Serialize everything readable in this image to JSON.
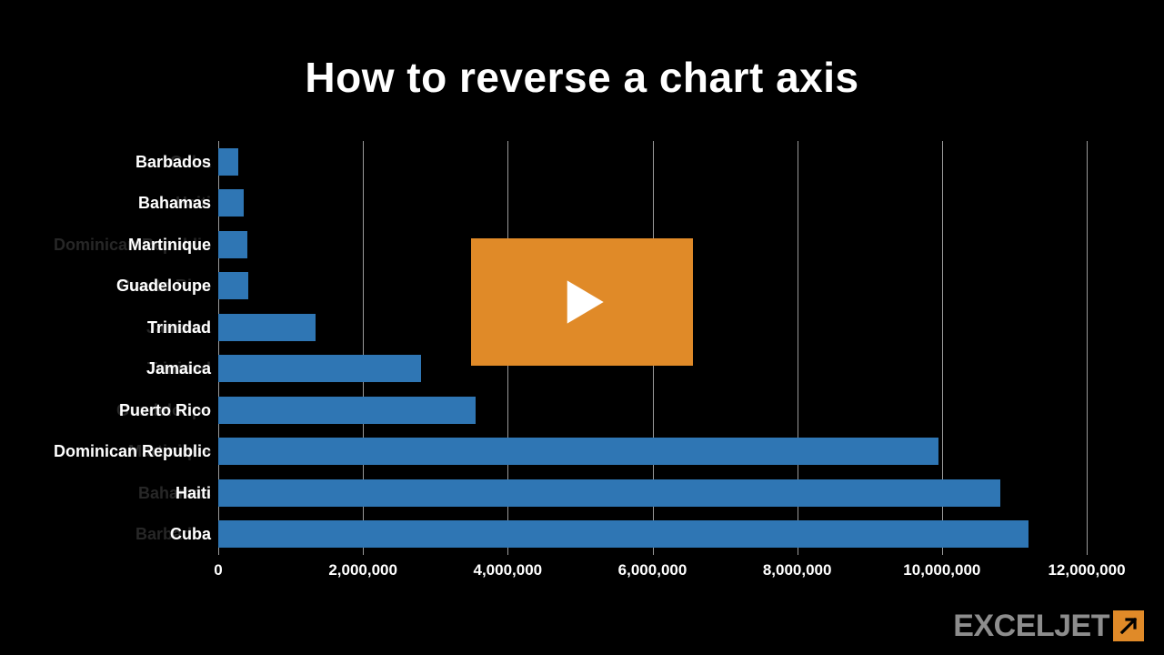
{
  "title": "How to reverse a chart axis",
  "logo_text": "EXCELJET",
  "chart_data": {
    "type": "bar",
    "orientation": "horizontal",
    "categories": [
      "Barbados",
      "Bahamas",
      "Martinique",
      "Guadeloupe",
      "Trinidad",
      "Jamaica",
      "Puerto Rico",
      "Dominican Republic",
      "Haiti",
      "Cuba"
    ],
    "values": [
      280000,
      350000,
      400000,
      420000,
      1350000,
      2800000,
      3550000,
      9950000,
      10800000,
      11200000
    ],
    "xlim": [
      0,
      12000000
    ],
    "x_ticks": [
      0,
      2000000,
      4000000,
      6000000,
      8000000,
      10000000,
      12000000
    ],
    "x_tick_labels": [
      "0",
      "2,000,000",
      "4,000,000",
      "6,000,000",
      "8,000,000",
      "10,000,000",
      "12,000,000"
    ],
    "title": "",
    "ylabel": "",
    "xlabel": ""
  },
  "bar_color": "#2f76b4",
  "accent_color": "#e08a28"
}
